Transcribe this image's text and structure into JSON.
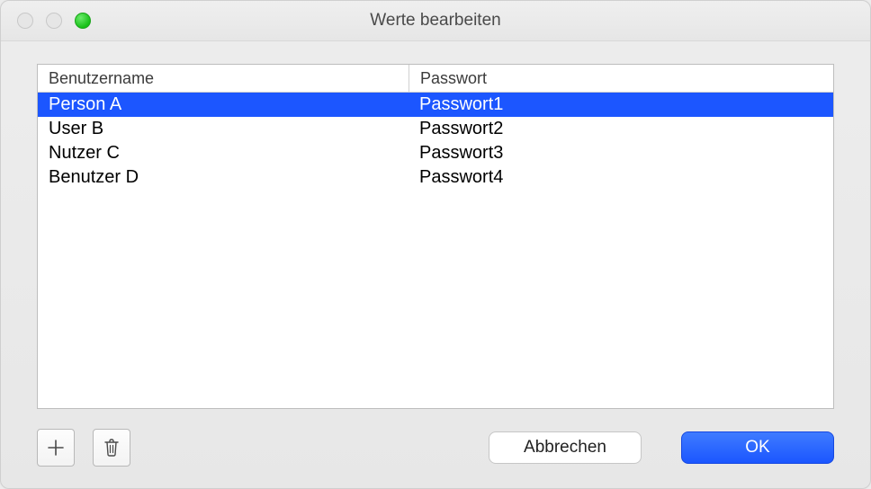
{
  "window": {
    "title": "Werte bearbeiten"
  },
  "table": {
    "columns": {
      "user": "Benutzername",
      "pass": "Passwort"
    },
    "rows": [
      {
        "user": "Person A",
        "pass": "Passwort1",
        "selected": true
      },
      {
        "user": "User B",
        "pass": "Passwort2",
        "selected": false
      },
      {
        "user": "Nutzer C",
        "pass": "Passwort3",
        "selected": false
      },
      {
        "user": "Benutzer D",
        "pass": "Passwort4",
        "selected": false
      }
    ]
  },
  "footer": {
    "add_label": "+",
    "cancel_label": "Abbrechen",
    "ok_label": "OK"
  },
  "colors": {
    "selection": "#1c56ff",
    "primary": "#1b56ff"
  }
}
